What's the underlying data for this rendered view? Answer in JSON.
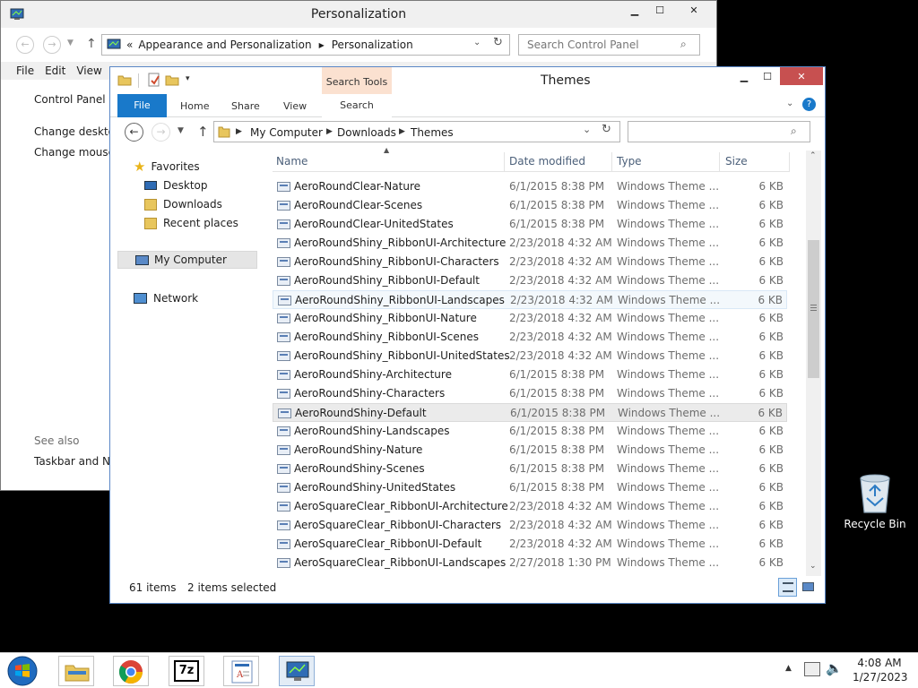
{
  "desktop": {
    "recycle_bin_label": "Recycle Bin"
  },
  "control_panel": {
    "title": "Personalization",
    "address": {
      "prefix": "«",
      "crumbs": [
        "Appearance and Personalization",
        "Personalization"
      ]
    },
    "search_placeholder": "Search Control Panel",
    "menu": [
      "File",
      "Edit",
      "View"
    ],
    "sidebar": {
      "home": "Control Panel H",
      "links": [
        "Change desktop",
        "Change mouse p"
      ],
      "see_also_heading": "See also",
      "see_also": [
        "Taskbar and Nav"
      ]
    }
  },
  "explorer": {
    "title": "Themes",
    "ribbon": {
      "file_tab": "File",
      "tabs": [
        "Home",
        "Share",
        "View"
      ],
      "contextual_group": "Search Tools",
      "contextual_tab": "Search"
    },
    "address": {
      "crumbs": [
        "My Computer",
        "Downloads",
        "Themes"
      ]
    },
    "search_value": "",
    "nav_pane": {
      "favorites_label": "Favorites",
      "favorites": [
        "Desktop",
        "Downloads",
        "Recent places"
      ],
      "computer_label": "My Computer",
      "network_label": "Network"
    },
    "columns": {
      "name": "Name",
      "date": "Date modified",
      "type": "Type",
      "size": "Size"
    },
    "files": [
      {
        "name": "AeroRoundClear-Nature",
        "date": "6/1/2015 8:38 PM",
        "type": "Windows Theme ...",
        "size": "6 KB"
      },
      {
        "name": "AeroRoundClear-Scenes",
        "date": "6/1/2015 8:38 PM",
        "type": "Windows Theme ...",
        "size": "6 KB"
      },
      {
        "name": "AeroRoundClear-UnitedStates",
        "date": "6/1/2015 8:38 PM",
        "type": "Windows Theme ...",
        "size": "6 KB"
      },
      {
        "name": "AeroRoundShiny_RibbonUI-Architecture",
        "date": "2/23/2018 4:32 AM",
        "type": "Windows Theme ...",
        "size": "6 KB"
      },
      {
        "name": "AeroRoundShiny_RibbonUI-Characters",
        "date": "2/23/2018 4:32 AM",
        "type": "Windows Theme ...",
        "size": "6 KB"
      },
      {
        "name": "AeroRoundShiny_RibbonUI-Default",
        "date": "2/23/2018 4:32 AM",
        "type": "Windows Theme ...",
        "size": "6 KB"
      },
      {
        "name": "AeroRoundShiny_RibbonUI-Landscapes",
        "date": "2/23/2018 4:32 AM",
        "type": "Windows Theme ...",
        "size": "6 KB"
      },
      {
        "name": "AeroRoundShiny_RibbonUI-Nature",
        "date": "2/23/2018 4:32 AM",
        "type": "Windows Theme ...",
        "size": "6 KB"
      },
      {
        "name": "AeroRoundShiny_RibbonUI-Scenes",
        "date": "2/23/2018 4:32 AM",
        "type": "Windows Theme ...",
        "size": "6 KB"
      },
      {
        "name": "AeroRoundShiny_RibbonUI-UnitedStates",
        "date": "2/23/2018 4:32 AM",
        "type": "Windows Theme ...",
        "size": "6 KB"
      },
      {
        "name": "AeroRoundShiny-Architecture",
        "date": "6/1/2015 8:38 PM",
        "type": "Windows Theme ...",
        "size": "6 KB"
      },
      {
        "name": "AeroRoundShiny-Characters",
        "date": "6/1/2015 8:38 PM",
        "type": "Windows Theme ...",
        "size": "6 KB"
      },
      {
        "name": "AeroRoundShiny-Default",
        "date": "6/1/2015 8:38 PM",
        "type": "Windows Theme ...",
        "size": "6 KB"
      },
      {
        "name": "AeroRoundShiny-Landscapes",
        "date": "6/1/2015 8:38 PM",
        "type": "Windows Theme ...",
        "size": "6 KB"
      },
      {
        "name": "AeroRoundShiny-Nature",
        "date": "6/1/2015 8:38 PM",
        "type": "Windows Theme ...",
        "size": "6 KB"
      },
      {
        "name": "AeroRoundShiny-Scenes",
        "date": "6/1/2015 8:38 PM",
        "type": "Windows Theme ...",
        "size": "6 KB"
      },
      {
        "name": "AeroRoundShiny-UnitedStates",
        "date": "6/1/2015 8:38 PM",
        "type": "Windows Theme ...",
        "size": "6 KB"
      },
      {
        "name": "AeroSquareClear_RibbonUI-Architecture",
        "date": "2/23/2018 4:32 AM",
        "type": "Windows Theme ...",
        "size": "6 KB"
      },
      {
        "name": "AeroSquareClear_RibbonUI-Characters",
        "date": "2/23/2018 4:32 AM",
        "type": "Windows Theme ...",
        "size": "6 KB"
      },
      {
        "name": "AeroSquareClear_RibbonUI-Default",
        "date": "2/23/2018 4:32 AM",
        "type": "Windows Theme ...",
        "size": "6 KB"
      },
      {
        "name": "AeroSquareClear_RibbonUI-Landscapes",
        "date": "2/27/2018 1:30 PM",
        "type": "Windows Theme ...",
        "size": "6 KB"
      }
    ],
    "hovered_row": 6,
    "selected_row": 12,
    "status": {
      "item_count": "61 items",
      "selection": "2 items selected"
    }
  },
  "taskbar": {
    "items": [
      "start-button",
      "file-explorer",
      "chrome",
      "7-zip",
      "wordpad",
      "control-panel"
    ],
    "clock_time": "4:08 AM",
    "clock_date": "1/27/2023"
  },
  "colors": {
    "accent": "#1979ca",
    "context_tab": "#fbe1d0",
    "header_text": "#4c607a"
  }
}
